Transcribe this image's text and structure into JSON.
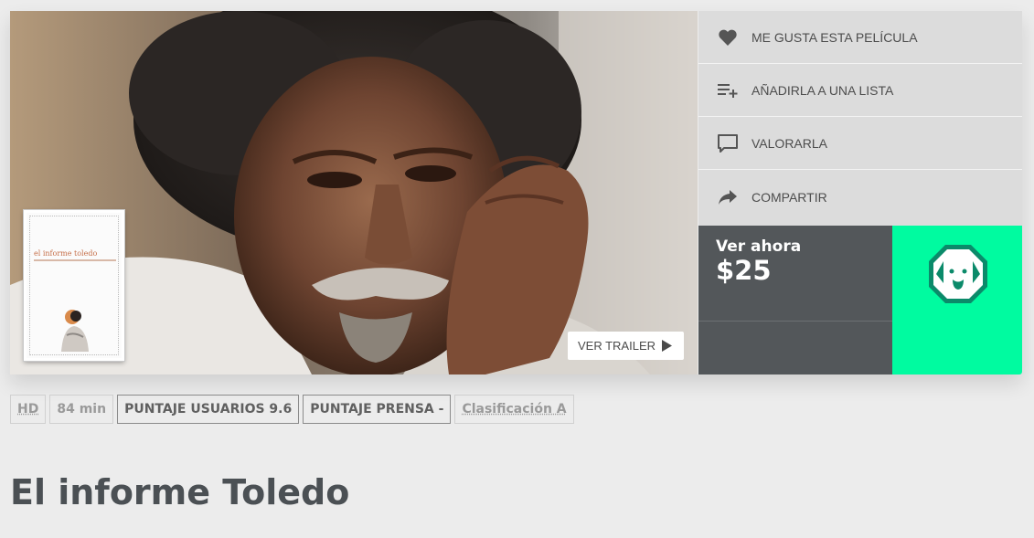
{
  "hero": {
    "trailer_label": "VER TRAILER",
    "poster_title": "el informe toledo"
  },
  "actions": [
    {
      "label": "ME GUSTA ESTA PELÍCULA",
      "icon": "heart-icon"
    },
    {
      "label": "AÑADIRLA A UNA LISTA",
      "icon": "playlist-add-icon"
    },
    {
      "label": "VALORARLA",
      "icon": "comment-icon"
    },
    {
      "label": "COMPARTIR",
      "icon": "share-icon"
    }
  ],
  "purchase": {
    "label": "Ver ahora",
    "price": "$25",
    "provider_icon": "dog-badge-icon",
    "provider_color": "#00fba0"
  },
  "tags": {
    "quality": "HD",
    "duration": "84 min",
    "user_score": "PUNTAJE USUARIOS 9.6",
    "press_score": "PUNTAJE PRENSA -",
    "rating": "Clasificación A"
  },
  "movie": {
    "title": "El informe Toledo"
  }
}
